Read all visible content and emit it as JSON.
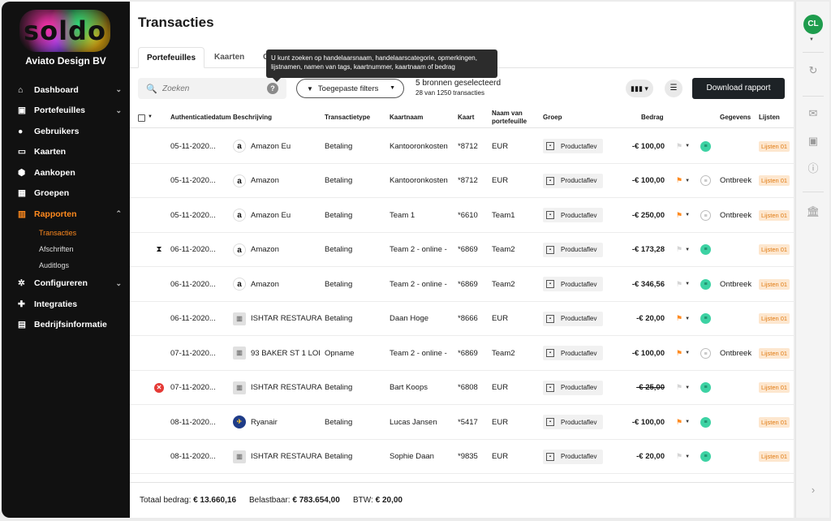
{
  "sidebar": {
    "logo": "soldo",
    "company": "Aviato Design BV",
    "items": [
      {
        "label": "Dashboard",
        "icon": "home-icon",
        "chevron": "⌄"
      },
      {
        "label": "Portefeuilles",
        "icon": "wallet-icon",
        "chevron": "⌄"
      },
      {
        "label": "Gebruikers",
        "icon": "user-icon",
        "chevron": ""
      },
      {
        "label": "Kaarten",
        "icon": "card-icon",
        "chevron": ""
      },
      {
        "label": "Aankopen",
        "icon": "purchase-icon",
        "chevron": ""
      },
      {
        "label": "Groepen",
        "icon": "group-icon",
        "chevron": ""
      },
      {
        "label": "Rapporten",
        "icon": "chart-icon",
        "chevron": "⌃"
      }
    ],
    "subitems": [
      "Transacties",
      "Afschriften",
      "Auditlogs"
    ],
    "items_after": [
      {
        "label": "Configureren",
        "icon": "gear-icon",
        "chevron": "⌄"
      },
      {
        "label": "Integraties",
        "icon": "puzzle-icon",
        "chevron": ""
      },
      {
        "label": "Bedrijfsinformatie",
        "icon": "building-icon",
        "chevron": ""
      }
    ]
  },
  "page": {
    "title": "Transacties",
    "tabs": [
      "Portefeuilles",
      "Kaarten",
      "G"
    ],
    "tooltip": "U kunt zoeken op handelaarsnaam, handelaarscategorie, opmerkingen, lijstnamen, namen van tags, kaartnummer, kaartnaam of bedrag"
  },
  "toolbar": {
    "search_placeholder": "Zoeken",
    "filter_label": "Toegepaste filters",
    "sources_line1": "5 bronnen geselecteerd",
    "sources_line2": "28 van 1250 transacties",
    "download_label": "Download rapport"
  },
  "table": {
    "headers": {
      "date": "Authenticatiedatum",
      "description": "Beschrijving",
      "type": "Transactietype",
      "cardname": "Kaartnaam",
      "card": "Kaart",
      "wallet": "Naam van portefeuille",
      "group": "Groep",
      "amount": "Bedrag",
      "details": "Gegevens",
      "lists": "Lijsten"
    },
    "rows": [
      {
        "status": "",
        "date": "05-11-2020...",
        "logo": "amazon",
        "merchant": "Amazon Eu",
        "type": "Betaling",
        "cardname": "Kantooronkosten",
        "card": "*8712",
        "wallet": "EUR",
        "group": "Productaflev",
        "amount": "-€ 100,00",
        "strike": false,
        "flag": "off",
        "receipt": "ok",
        "details": "",
        "list": "Lijsten 01"
      },
      {
        "status": "",
        "date": "05-11-2020...",
        "logo": "amazon",
        "merchant": "Amazon",
        "type": "Betaling",
        "cardname": "Kantooronkosten",
        "card": "*8712",
        "wallet": "EUR",
        "group": "Productaflev",
        "amount": "-€ 100,00",
        "strike": false,
        "flag": "on",
        "receipt": "missing",
        "details": "Ontbreek",
        "list": "Lijsten 01"
      },
      {
        "status": "",
        "date": "05-11-2020...",
        "logo": "amazon",
        "merchant": "Amazon Eu",
        "type": "Betaling",
        "cardname": "Team 1",
        "card": "*6610",
        "wallet": "Team1",
        "group": "Productaflev",
        "amount": "-€ 250,00",
        "strike": false,
        "flag": "on",
        "receipt": "missing",
        "details": "Ontbreek",
        "list": "Lijsten 01"
      },
      {
        "status": "pending",
        "date": "06-11-2020...",
        "logo": "amazon",
        "merchant": "Amazon",
        "type": "Betaling",
        "cardname": "Team 2 - online -",
        "card": "*6869",
        "wallet": "Team2",
        "group": "Productaflev",
        "amount": "-€ 173,28",
        "strike": false,
        "flag": "off",
        "receipt": "ok",
        "details": "",
        "list": "Lijsten 01"
      },
      {
        "status": "",
        "date": "06-11-2020...",
        "logo": "amazon",
        "merchant": "Amazon",
        "type": "Betaling",
        "cardname": "Team 2 - online -",
        "card": "*6869",
        "wallet": "Team2",
        "group": "Productaflev",
        "amount": "-€ 346,56",
        "strike": false,
        "flag": "off",
        "receipt": "ok",
        "details": "Ontbreek",
        "list": "Lijsten 01"
      },
      {
        "status": "",
        "date": "06-11-2020...",
        "logo": "generic",
        "merchant": "ISHTAR RESTAURA",
        "type": "Betaling",
        "cardname": "Daan Hoge",
        "card": "*8666",
        "wallet": "EUR",
        "group": "Productaflev",
        "amount": "-€ 20,00",
        "strike": false,
        "flag": "on",
        "receipt": "ok",
        "details": "",
        "list": "Lijsten 01"
      },
      {
        "status": "",
        "date": "07-11-2020...",
        "logo": "generic",
        "merchant": "93 BAKER ST 1 LOI",
        "type": "Opname",
        "cardname": "Team 2 - online -",
        "card": "*6869",
        "wallet": "Team2",
        "group": "Productaflev",
        "amount": "-€ 100,00",
        "strike": false,
        "flag": "on",
        "receipt": "missing",
        "details": "Ontbreek",
        "list": "Lijsten 01"
      },
      {
        "status": "error",
        "date": "07-11-2020...",
        "logo": "generic",
        "merchant": "ISHTAR RESTAURA",
        "type": "Betaling",
        "cardname": "Bart Koops",
        "card": "*6808",
        "wallet": "EUR",
        "group": "Productaflev",
        "amount": "-€ 25,00",
        "strike": true,
        "flag": "off",
        "receipt": "ok",
        "details": "",
        "list": "Lijsten 01"
      },
      {
        "status": "",
        "date": "08-11-2020...",
        "logo": "ryanair",
        "merchant": "Ryanair",
        "type": "Betaling",
        "cardname": "Lucas Jansen",
        "card": "*5417",
        "wallet": "EUR",
        "group": "Productaflev",
        "amount": "-€ 100,00",
        "strike": false,
        "flag": "on",
        "receipt": "ok",
        "details": "",
        "list": "Lijsten 01"
      },
      {
        "status": "",
        "date": "08-11-2020...",
        "logo": "generic",
        "merchant": "ISHTAR RESTAURA",
        "type": "Betaling",
        "cardname": "Sophie Daan",
        "card": "*9835",
        "wallet": "EUR",
        "group": "Productaflev",
        "amount": "-€ 20,00",
        "strike": false,
        "flag": "off",
        "receipt": "ok",
        "details": "",
        "list": "Lijsten 01"
      }
    ]
  },
  "footer": {
    "total_label": "Totaal bedrag:",
    "total_value": "€ 13.660,16",
    "taxable_label": "Belastbaar:",
    "taxable_value": "€ 783.654,00",
    "vat_label": "BTW:",
    "vat_value": "€ 20,00"
  },
  "user": {
    "initials": "CL"
  },
  "colors": {
    "accent": "#ff8a1e",
    "sidebar": "#111111",
    "primary_button": "#1d2226",
    "receipt_ok": "#3dd2a3",
    "avatar": "#1e9c4d",
    "error": "#e53935"
  }
}
